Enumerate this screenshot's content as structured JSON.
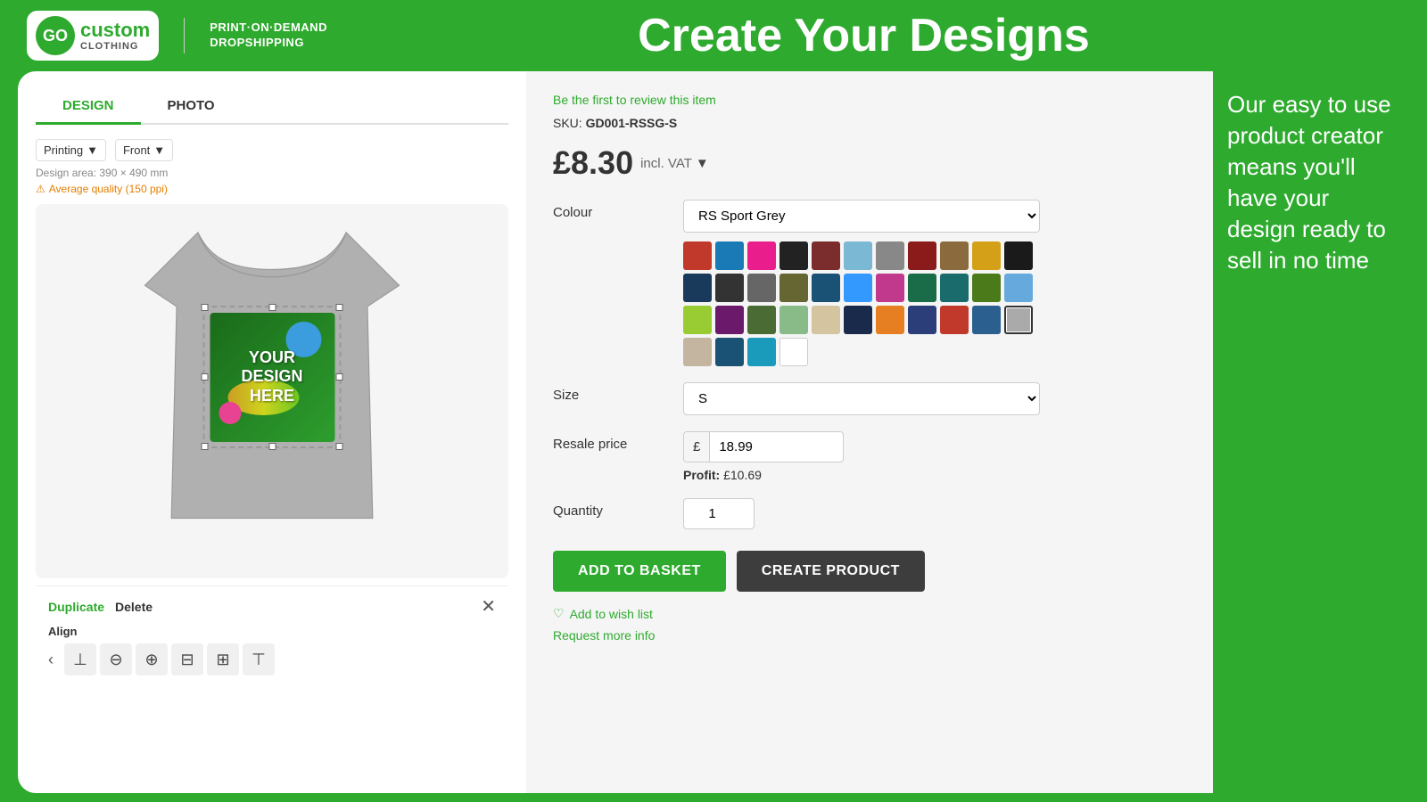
{
  "header": {
    "logo": {
      "go_text": "GO",
      "custom_text": "custom",
      "clothing_text": "CLOTHING",
      "tagline_line1": "PRINT·ON·DEMAND",
      "tagline_line2": "DROPSHIPPING"
    },
    "title": "Create Your Designs"
  },
  "left_panel": {
    "tabs": [
      {
        "label": "DESIGN",
        "active": true
      },
      {
        "label": "PHOTO",
        "active": false
      }
    ],
    "printing_label": "Printing",
    "front_label": "Front",
    "design_area_label": "Design area: 390 × 490 mm",
    "quality_warning": "Average quality (150 ppi)",
    "duplicate_label": "Duplicate",
    "delete_label": "Delete",
    "align_label": "Align"
  },
  "product": {
    "review_text": "Be the first to review this item",
    "sku_label": "SKU:",
    "sku_value": "GD001-RSSG-S",
    "price": "£8.30",
    "price_vat": "incl. VAT",
    "colour_label": "Colour",
    "colour_selected": "RS Sport Grey",
    "size_label": "Size",
    "size_selected": "S",
    "resale_label": "Resale price",
    "currency_symbol": "£",
    "resale_value": "18.99",
    "profit_label": "Profit:",
    "profit_value": "£10.69",
    "quantity_label": "Quantity",
    "quantity_value": "1",
    "btn_basket": "ADD TO BASKET",
    "btn_create": "CREATE PRODUCT",
    "wishlist_text": "Add to wish list",
    "request_text": "Request more info"
  },
  "right_panel": {
    "text": "Our easy to use product creator means you'll have your design ready to sell in no time"
  },
  "colors": [
    "#c0392b",
    "#1a7ab5",
    "#e91e8c",
    "#222222",
    "#7b2d2d",
    "#7bb8d4",
    "#888888",
    "#8b1a1a",
    "#8b6a3e",
    "#d4a017",
    "#1a1a1a",
    "#1a3a5c",
    "#333333",
    "#666666",
    "#666633",
    "#1a5276",
    "#3399ff",
    "#c0398c",
    "#1a6b47",
    "#1a6b6b",
    "#4a7a1a",
    "#66aadd",
    "#99cc33",
    "#6b1a6b",
    "#4a6b33",
    "#88bb88",
    "#d4c4a0",
    "#1a2a4a",
    "#e67e22",
    "#2c3e7a",
    "#c0392b",
    "#2a5f8f",
    "#888888",
    "#c4b5a0",
    "#1a5276"
  ],
  "color_selected_index": 32
}
